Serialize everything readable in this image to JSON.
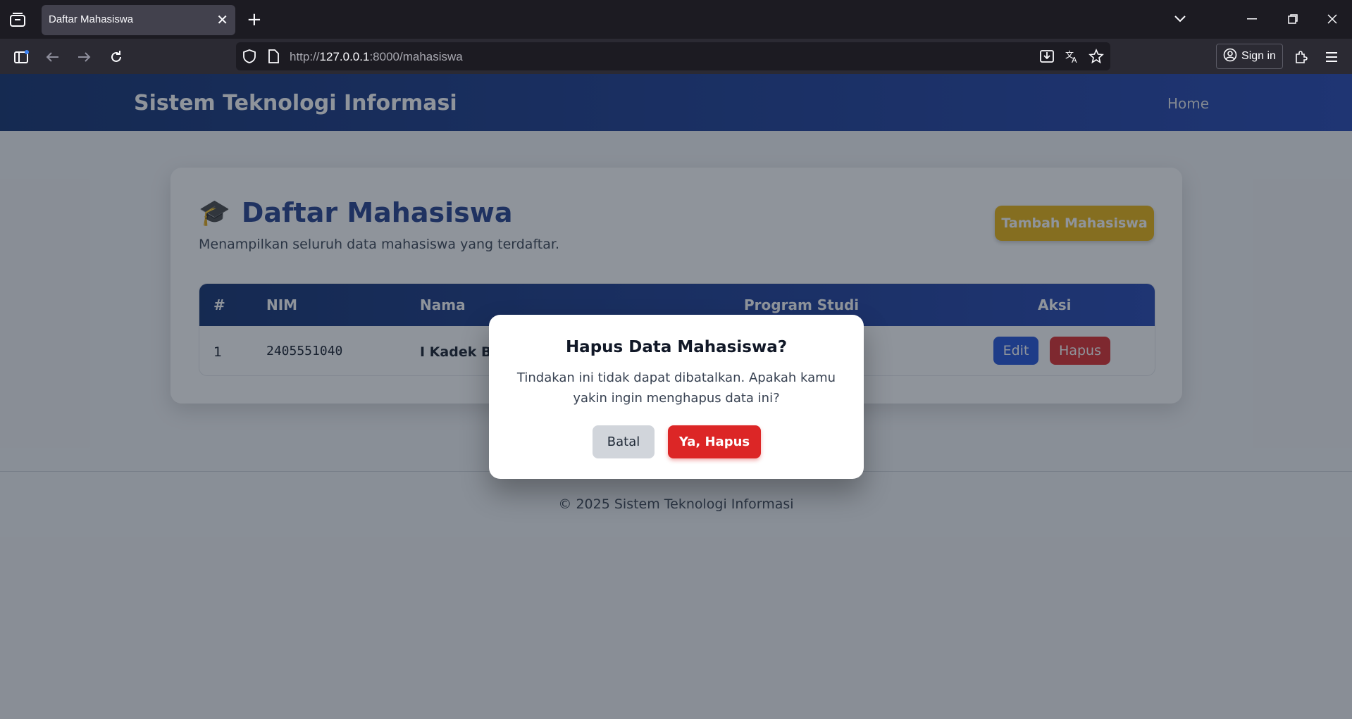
{
  "browser": {
    "tab_title": "Daftar Mahasiswa",
    "url_prefix": "http://",
    "url_host": "127.0.0.1",
    "url_path": ":8000/mahasiswa",
    "sign_in_label": "Sign in"
  },
  "site": {
    "brand": "Sistem Teknologi Informasi",
    "nav_home": "Home"
  },
  "card": {
    "icon": "🎓",
    "title": "Daftar Mahasiswa",
    "subtitle": "Menampilkan seluruh data mahasiswa yang terdaftar.",
    "add_button": "Tambah Mahasiswa"
  },
  "table": {
    "headers": [
      "#",
      "NIM",
      "Nama",
      "Program Studi",
      "Aksi"
    ],
    "rows": [
      {
        "no": "1",
        "nim": "2405551040",
        "nama": "I Kadek Bin",
        "prodi": "",
        "edit": "Edit",
        "hapus": "Hapus"
      }
    ]
  },
  "footer": "© 2025 Sistem Teknologi Informasi",
  "modal": {
    "title": "Hapus Data Mahasiswa?",
    "text": "Tindakan ini tidak dapat dibatalkan. Apakah kamu yakin ingin menghapus data ini?",
    "cancel": "Batal",
    "confirm": "Ya, Hapus"
  },
  "colors": {
    "header_start": "#0b2a6b",
    "header_end": "#1e40af",
    "title_blue": "#1e3a8a",
    "add_yellow": "#eab308",
    "danger_red": "#dc2626",
    "edit_blue": "#1d4ed8"
  }
}
